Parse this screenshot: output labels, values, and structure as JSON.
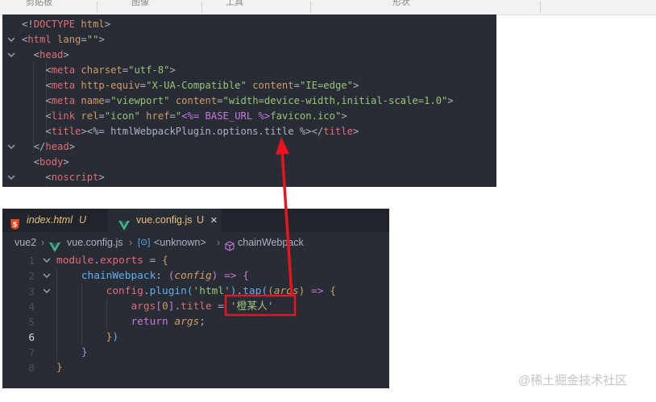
{
  "ribbon": {
    "labels": [
      "剪贴板",
      "图像",
      "工具",
      "形状"
    ]
  },
  "top_editor": {
    "lines": [
      [
        [
          "t-pun",
          "<!"
        ],
        [
          "t-tag",
          "DOCTYPE"
        ],
        [
          "t-plain",
          " "
        ],
        [
          "t-attr",
          "html"
        ],
        [
          "t-pun",
          ">"
        ]
      ],
      [
        [
          "t-pun",
          "<"
        ],
        [
          "t-tag",
          "html"
        ],
        [
          "t-plain",
          " "
        ],
        [
          "t-attr",
          "lang"
        ],
        [
          "t-pun",
          "="
        ],
        [
          "t-str",
          "\"\""
        ],
        [
          "t-pun",
          ">"
        ]
      ],
      [
        [
          "t-plain",
          "  "
        ],
        [
          "t-pun",
          "<"
        ],
        [
          "t-tag",
          "head"
        ],
        [
          "t-pun",
          ">"
        ]
      ],
      [
        [
          "t-plain",
          "    "
        ],
        [
          "t-pun",
          "<"
        ],
        [
          "t-tag",
          "meta"
        ],
        [
          "t-plain",
          " "
        ],
        [
          "t-attr",
          "charset"
        ],
        [
          "t-pun",
          "="
        ],
        [
          "t-str",
          "\"utf-8\""
        ],
        [
          "t-pun",
          ">"
        ]
      ],
      [
        [
          "t-plain",
          "    "
        ],
        [
          "t-pun",
          "<"
        ],
        [
          "t-tag",
          "meta"
        ],
        [
          "t-plain",
          " "
        ],
        [
          "t-attr",
          "http-equiv"
        ],
        [
          "t-pun",
          "="
        ],
        [
          "t-str",
          "\"X-UA-Compatible\""
        ],
        [
          "t-plain",
          " "
        ],
        [
          "t-attr",
          "content"
        ],
        [
          "t-pun",
          "="
        ],
        [
          "t-str",
          "\"IE=edge\""
        ],
        [
          "t-pun",
          ">"
        ]
      ],
      [
        [
          "t-plain",
          "    "
        ],
        [
          "t-pun",
          "<"
        ],
        [
          "t-tag",
          "meta"
        ],
        [
          "t-plain",
          " "
        ],
        [
          "t-attr",
          "name"
        ],
        [
          "t-pun",
          "="
        ],
        [
          "t-str",
          "\"viewport\""
        ],
        [
          "t-plain",
          " "
        ],
        [
          "t-attr",
          "content"
        ],
        [
          "t-pun",
          "="
        ],
        [
          "t-str",
          "\"width=device-width,initial-scale=1.0\""
        ],
        [
          "t-pun",
          ">"
        ]
      ],
      [
        [
          "t-plain",
          "    "
        ],
        [
          "t-pun",
          "<"
        ],
        [
          "t-tag",
          "link"
        ],
        [
          "t-plain",
          " "
        ],
        [
          "t-attr",
          "rel"
        ],
        [
          "t-pun",
          "="
        ],
        [
          "t-str",
          "\"icon\""
        ],
        [
          "t-plain",
          " "
        ],
        [
          "t-attr",
          "href"
        ],
        [
          "t-pun",
          "="
        ],
        [
          "t-str",
          "\""
        ],
        [
          "t-tpl",
          "<%= BASE_URL %>"
        ],
        [
          "t-str",
          "favicon.ico\""
        ],
        [
          "t-pun",
          ">"
        ]
      ],
      [
        [
          "t-plain",
          "    "
        ],
        [
          "t-pun",
          "<"
        ],
        [
          "t-tag",
          "title"
        ],
        [
          "t-pun",
          ">"
        ],
        [
          "t-plain",
          "<%= htmlWebpackPlugin.options.title %>"
        ],
        [
          "t-pun",
          "</"
        ],
        [
          "t-tag",
          "title"
        ],
        [
          "t-pun",
          ">"
        ]
      ],
      [
        [
          "t-plain",
          "  "
        ],
        [
          "t-pun",
          "</"
        ],
        [
          "t-tag",
          "head"
        ],
        [
          "t-pun",
          ">"
        ]
      ],
      [
        [
          "t-plain",
          "  "
        ],
        [
          "t-pun",
          "<"
        ],
        [
          "t-tag",
          "body"
        ],
        [
          "t-pun",
          ">"
        ]
      ],
      [
        [
          "t-plain",
          "    "
        ],
        [
          "t-pun",
          "<"
        ],
        [
          "t-tag",
          "noscript"
        ],
        [
          "t-pun",
          ">"
        ]
      ]
    ]
  },
  "tabs": [
    {
      "label": "index.html",
      "badge": "U",
      "active": false
    },
    {
      "label": "vue.config.js",
      "badge": "U",
      "active": true,
      "close": "×"
    }
  ],
  "breadcrumb": {
    "root": "vue2",
    "file": "vue.config.js",
    "scope": "<unknown>",
    "symbol": "chainWebpack"
  },
  "bottom_editor": {
    "line_numbers": [
      "1",
      "2",
      "3",
      "4",
      "5",
      "6",
      "7",
      "8"
    ],
    "current_line": 6,
    "lines": [
      [
        [
          "k-prop",
          "module"
        ],
        [
          "t-plain",
          "."
        ],
        [
          "k-prop",
          "exports"
        ],
        [
          "t-plain",
          " = "
        ],
        [
          "k-par1",
          "{"
        ]
      ],
      [
        [
          "t-plain",
          "    "
        ],
        [
          "k-fn",
          "chainWebpack"
        ],
        [
          "t-plain",
          ": "
        ],
        [
          "k-par2",
          "("
        ],
        [
          "k-param",
          "config"
        ],
        [
          "k-par2",
          ")"
        ],
        [
          "t-plain",
          " "
        ],
        [
          "k-kw",
          "=>"
        ],
        [
          "t-plain",
          " "
        ],
        [
          "k-par2",
          "{"
        ]
      ],
      [
        [
          "t-plain",
          "        "
        ],
        [
          "k-prop",
          "config"
        ],
        [
          "t-plain",
          "."
        ],
        [
          "k-fn",
          "plugin"
        ],
        [
          "k-par3",
          "("
        ],
        [
          "k-str",
          "'html'"
        ],
        [
          "k-par3",
          ")"
        ],
        [
          "t-plain",
          "."
        ],
        [
          "k-fn",
          "tap"
        ],
        [
          "k-par3",
          "("
        ],
        [
          "k-par1",
          "("
        ],
        [
          "k-param",
          "args"
        ],
        [
          "k-par1",
          ")"
        ],
        [
          "t-plain",
          " "
        ],
        [
          "k-kw",
          "=>"
        ],
        [
          "t-plain",
          " "
        ],
        [
          "k-par1",
          "{"
        ]
      ],
      [
        [
          "t-plain",
          "            "
        ],
        [
          "k-prop",
          "args"
        ],
        [
          "k-par2",
          "["
        ],
        [
          "k-num",
          "0"
        ],
        [
          "k-par2",
          "]"
        ],
        [
          "t-plain",
          "."
        ],
        [
          "k-prop",
          "title"
        ],
        [
          "t-plain",
          " = "
        ],
        [
          "k-str",
          "'橙某人'"
        ]
      ],
      [
        [
          "t-plain",
          "            "
        ],
        [
          "k-kw",
          "return"
        ],
        [
          "t-plain",
          " "
        ],
        [
          "k-param",
          "args"
        ],
        [
          "t-plain",
          ";"
        ]
      ],
      [
        [
          "t-plain",
          "        "
        ],
        [
          "k-par1",
          "}"
        ],
        [
          "k-par3",
          ")"
        ]
      ],
      [
        [
          "t-plain",
          "    "
        ],
        [
          "k-par2",
          "}"
        ]
      ],
      [
        [
          "k-par1",
          "}"
        ]
      ]
    ]
  },
  "watermark": "@稀土掘金技术社区",
  "colors": {
    "editor_bg": "#282c34",
    "annotation_red": "#e8141e"
  }
}
